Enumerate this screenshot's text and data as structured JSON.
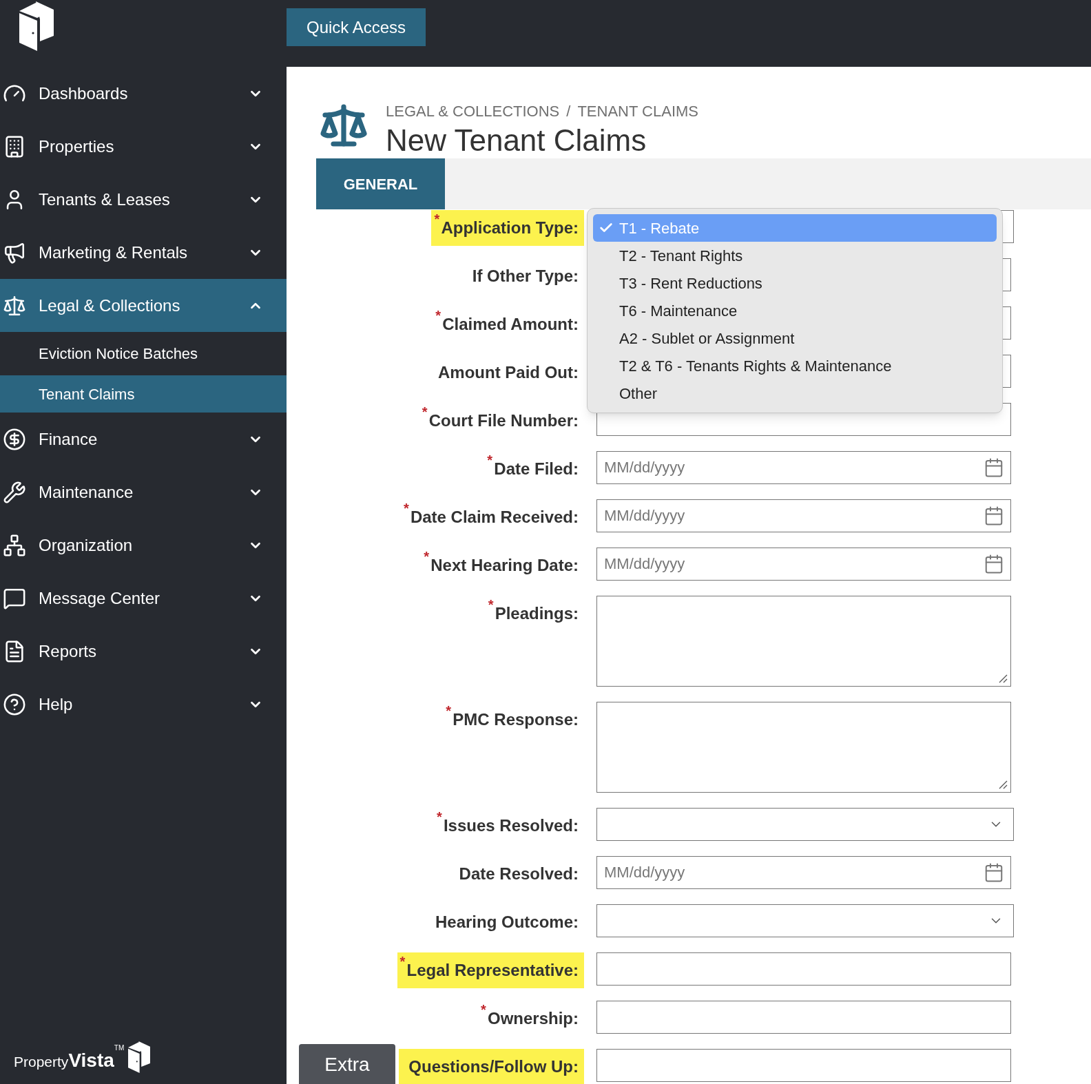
{
  "sidebar": {
    "nav": [
      {
        "label": "Dashboards",
        "expanded": false,
        "selected": false
      },
      {
        "label": "Properties",
        "expanded": false,
        "selected": false
      },
      {
        "label": "Tenants & Leases",
        "expanded": false,
        "selected": false
      },
      {
        "label": "Marketing & Rentals",
        "expanded": false,
        "selected": false
      },
      {
        "label": "Legal & Collections",
        "expanded": true,
        "selected": true,
        "children": [
          {
            "label": "Eviction Notice Batches",
            "selected": false
          },
          {
            "label": "Tenant Claims",
            "selected": true
          }
        ]
      },
      {
        "label": "Finance",
        "expanded": false,
        "selected": false
      },
      {
        "label": "Maintenance",
        "expanded": false,
        "selected": false
      },
      {
        "label": "Organization",
        "expanded": false,
        "selected": false
      },
      {
        "label": "Message Center",
        "expanded": false,
        "selected": false
      },
      {
        "label": "Reports",
        "expanded": false,
        "selected": false
      },
      {
        "label": "Help",
        "expanded": false,
        "selected": false
      }
    ],
    "brand": {
      "light": "Property",
      "bold": "Vista",
      "mark": "TM"
    }
  },
  "topbar": {
    "button": "Quick Access"
  },
  "header": {
    "breadcrumb": [
      "LEGAL & COLLECTIONS",
      "TENANT CLAIMS"
    ],
    "separator": "/",
    "title": "New Tenant Claims"
  },
  "tabs": [
    {
      "label": "GENERAL",
      "selected": true
    }
  ],
  "form": {
    "fields": [
      {
        "label": "Application Type:",
        "required": true,
        "highlighted": true,
        "kind": "select",
        "open": true
      },
      {
        "label": "If Other Type:",
        "required": false,
        "highlighted": false,
        "kind": "text"
      },
      {
        "label": "Claimed Amount:",
        "required": true,
        "highlighted": false,
        "kind": "text"
      },
      {
        "label": "Amount Paid Out:",
        "required": false,
        "highlighted": false,
        "kind": "text"
      },
      {
        "label": "Court File Number:",
        "required": true,
        "highlighted": false,
        "kind": "text"
      },
      {
        "label": "Date Filed:",
        "required": true,
        "highlighted": false,
        "kind": "date",
        "placeholder": "MM/dd/yyyy"
      },
      {
        "label": "Date Claim Received:",
        "required": true,
        "highlighted": false,
        "kind": "date",
        "placeholder": "MM/dd/yyyy"
      },
      {
        "label": "Next Hearing Date:",
        "required": true,
        "highlighted": false,
        "kind": "date",
        "placeholder": "MM/dd/yyyy"
      },
      {
        "label": "Pleadings:",
        "required": true,
        "highlighted": false,
        "kind": "textarea"
      },
      {
        "label": "PMC Response:",
        "required": true,
        "highlighted": false,
        "kind": "textarea"
      },
      {
        "label": "Issues Resolved:",
        "required": true,
        "highlighted": false,
        "kind": "select"
      },
      {
        "label": "Date Resolved:",
        "required": false,
        "highlighted": false,
        "kind": "date",
        "placeholder": "MM/dd/yyyy"
      },
      {
        "label": "Hearing Outcome:",
        "required": false,
        "highlighted": false,
        "kind": "select"
      },
      {
        "label": "Legal Representative:",
        "required": true,
        "highlighted": true,
        "kind": "text"
      },
      {
        "label": "Ownership:",
        "required": true,
        "highlighted": false,
        "kind": "text"
      },
      {
        "label": "Questions/Follow Up:",
        "required": false,
        "highlighted": true,
        "kind": "text"
      }
    ],
    "required_mark": "*"
  },
  "dropdown": {
    "options": [
      {
        "label": "T1 - Rebate",
        "selected": true
      },
      {
        "label": "T2 - Tenant Rights",
        "selected": false
      },
      {
        "label": "T3 - Rent Reductions",
        "selected": false
      },
      {
        "label": "T6 - Maintenance",
        "selected": false
      },
      {
        "label": "A2 - Sublet or Assignment",
        "selected": false
      },
      {
        "label": "T2 & T6 - Tenants Rights & Maintenance",
        "selected": false
      },
      {
        "label": "Other",
        "selected": false
      }
    ]
  },
  "extra_button": "Extra"
}
